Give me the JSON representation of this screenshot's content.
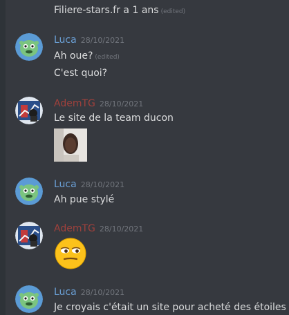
{
  "colors": {
    "background": "#36393f",
    "luca_name": "#6ba0d6",
    "ademtg_name": "#a0413c",
    "text": "#dcddde",
    "muted": "#72767d"
  },
  "messages": [
    {
      "type": "continuation",
      "text": "Filiere-stars.fr a 1 ans",
      "edited": "(edited)"
    },
    {
      "type": "group",
      "author": "Luca",
      "timestamp": "28/10/2021",
      "avatar_icon": "green-creature-avatar-icon",
      "lines": [
        {
          "text": "Ah oue?",
          "edited": "(edited)"
        },
        {
          "text": "C'est quoi?"
        }
      ]
    },
    {
      "type": "group",
      "author": "AdemTG",
      "timestamp": "28/10/2021",
      "avatar_icon": "blue-chart-avatar-icon",
      "lines": [
        {
          "text": "Le site de la team ducon"
        }
      ],
      "attachment": "image-attachment"
    },
    {
      "type": "group",
      "author": "Luca",
      "timestamp": "28/10/2021",
      "avatar_icon": "green-creature-avatar-icon",
      "lines": [
        {
          "text": "Ah pue stylé"
        }
      ]
    },
    {
      "type": "group",
      "author": "AdemTG",
      "timestamp": "28/10/2021",
      "avatar_icon": "blue-chart-avatar-icon",
      "emoji": "smirk-emoji-icon"
    },
    {
      "type": "group",
      "author": "Luca",
      "timestamp": "28/10/2021",
      "avatar_icon": "green-creature-avatar-icon",
      "lines": [
        {
          "text": "Je croyais c'était un site pour acheté des étoiles"
        }
      ]
    }
  ]
}
